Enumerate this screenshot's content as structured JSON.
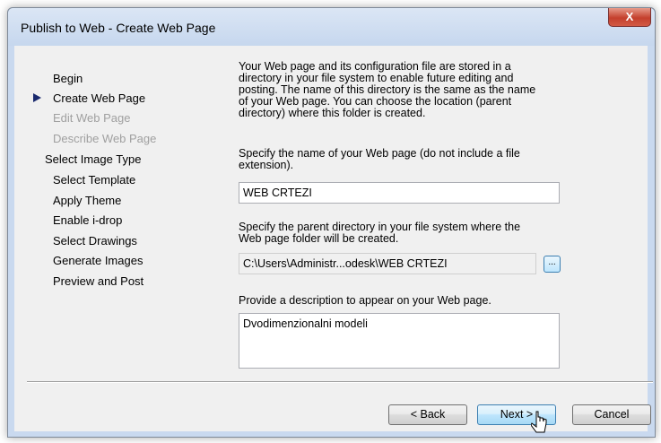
{
  "window": {
    "title": "Publish to Web - Create Web Page",
    "close_glyph": "X"
  },
  "steps": [
    {
      "label": "Begin",
      "state": "normal"
    },
    {
      "label": "Create Web Page",
      "state": "current"
    },
    {
      "label": "Edit Web Page",
      "state": "disabled"
    },
    {
      "label": "Describe Web Page",
      "state": "disabled"
    },
    {
      "label": "Select Image Type",
      "state": "normal"
    },
    {
      "label": "Select Template",
      "state": "normal"
    },
    {
      "label": "Apply Theme",
      "state": "normal"
    },
    {
      "label": "Enable i-drop",
      "state": "normal"
    },
    {
      "label": "Select Drawings",
      "state": "normal"
    },
    {
      "label": "Generate Images",
      "state": "normal"
    },
    {
      "label": "Preview and Post",
      "state": "normal"
    }
  ],
  "intro_lines": [
    "Your Web page and its configuration file are stored in a",
    "directory in your file system to enable future editing and",
    "posting.  The name of this directory is the same as the name",
    "of your Web page.  You can choose the location (parent",
    "directory) where this folder is created."
  ],
  "name_prompt_lines": [
    "Specify the name of your Web page (do not include a file",
    "extension)."
  ],
  "name_value": "WEB CRTEZI",
  "dir_prompt_lines": [
    "Specify the parent directory in your file system where the",
    "Web page folder will be created."
  ],
  "dir_value": "C:\\Users\\Administr...odesk\\WEB CRTEZI",
  "browse_label": "...",
  "desc_prompt": "Provide a description to appear on your Web page.",
  "desc_value": "Dvodimenzionalni modeli",
  "buttons": {
    "back": "< Back",
    "next": "Next >",
    "cancel": "Cancel"
  }
}
